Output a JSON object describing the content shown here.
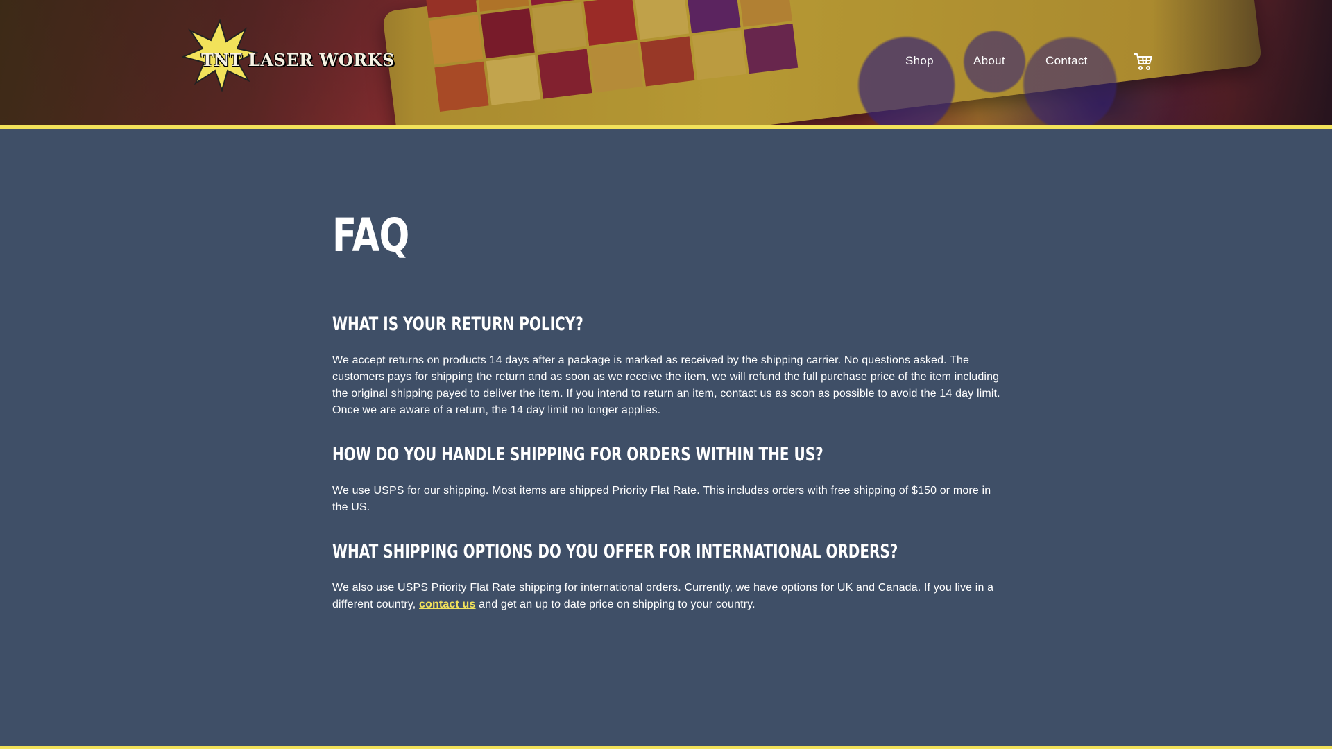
{
  "brand": {
    "logo_text": "TNT LASER WORKS",
    "accent": "#f2e25a",
    "background": "#3f4f67"
  },
  "nav": {
    "items": [
      "Shop",
      "About",
      "Contact"
    ],
    "cart_icon": "cart-icon"
  },
  "page": {
    "title": "FAQ"
  },
  "faq": [
    {
      "question": "WHAT IS YOUR RETURN POLICY?",
      "answer": "We accept returns on products 14 days after a package is marked as received by the shipping carrier. No questions asked. The customers pays for shipping the return and as soon as we receive the item, we will refund the full purchase price of the item including the original shipping payed to deliver the item. If you intend to return an item, contact us as soon as possible to avoid the 14 day limit. Once we are aware of a return, the 14 day limit no longer applies."
    },
    {
      "question": "HOW DO YOU HANDLE SHIPPING FOR ORDERS WITHIN THE US?",
      "answer": "We use USPS for our shipping. Most items are shipped Priority Flat Rate. This includes orders with free shipping of $150 or more in the US."
    },
    {
      "question": "WHAT SHIPPING OPTIONS DO YOU OFFER FOR INTERNATIONAL ORDERS?",
      "answer_before": "We also use USPS Priority Flat Rate shipping for international orders. Currently, we have options for UK and Canada. If you live in a different country,",
      "link_text": "contact us",
      "answer_after": "and get an up to date price on shipping to your country."
    }
  ]
}
